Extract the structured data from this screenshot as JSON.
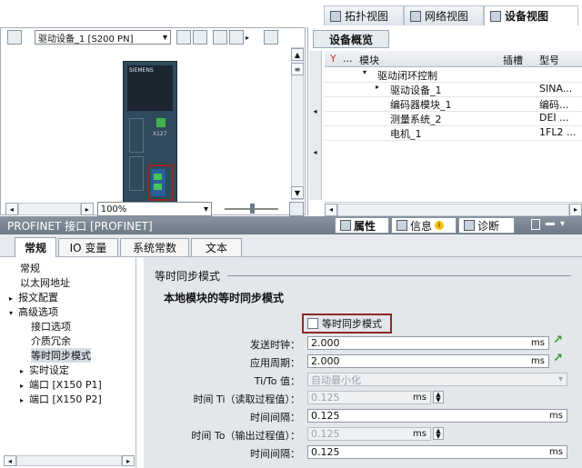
{
  "top_tabs": [
    {
      "label": "拓扑视图",
      "icon": "topology-icon"
    },
    {
      "label": "网络视图",
      "icon": "network-icon"
    },
    {
      "label": "设备视图",
      "icon": "device-icon"
    }
  ],
  "device_toolbar": {
    "device_select": "驱动设备_1 [S200 PN]"
  },
  "device_graphic": {
    "brand": "SIEMENS",
    "port_label": "X127"
  },
  "zoom": {
    "value": "100%"
  },
  "overview": {
    "tab": "设备概览",
    "headers": {
      "module": "模块",
      "slot": "插槽",
      "type": "型号"
    },
    "rows": [
      {
        "name": "驱动闭环控制",
        "slot": "",
        "type": ""
      },
      {
        "name": "驱动设备_1",
        "slot": "",
        "type": "SINA..."
      },
      {
        "name": "编码器模块_1",
        "slot": "",
        "type": "编码..."
      },
      {
        "name": "测量系统_2",
        "slot": "",
        "type": "DEI ..."
      },
      {
        "name": "电机_1",
        "slot": "",
        "type": "1FL2 ..."
      }
    ]
  },
  "inspector": {
    "title": "PROFINET 接口 [PROFINET]",
    "right_tabs": {
      "properties": "属性",
      "info": "信息",
      "diagnostics": "诊断"
    }
  },
  "prop_tabs": [
    "常规",
    "IO 变量",
    "系统常数",
    "文本"
  ],
  "nav": {
    "items": [
      "常规",
      "以太网地址",
      "报文配置",
      "高级选项",
      "接口选项",
      "介质冗余",
      "等时同步模式",
      "实时设定",
      "端口 [X150 P1]",
      "端口 [X150 P2]"
    ]
  },
  "content": {
    "section": "等时同步模式",
    "subsection": "本地模块的等时同步模式",
    "checkbox_label": "等时同步模式",
    "fields": {
      "send_clock_label": "发送时钟：",
      "send_clock": "2.000",
      "app_cycle_label": "应用周期：",
      "app_cycle": "2.000",
      "titoval_label": "Ti/To 值：",
      "titoval": "自动最小化",
      "ti_label": "时间 Ti（读取过程值）：",
      "ti": "0.125",
      "ti_interval_label": "时间间隔：",
      "ti_interval": "0.125",
      "to_label": "时间 To（输出过程值）：",
      "to": "0.125",
      "to_interval_label": "时间间隔：",
      "to_interval": "0.125",
      "unit": "ms"
    }
  },
  "colors": {
    "highlight": "#8f2a25",
    "accent_arrow": "#2d9a2d"
  }
}
